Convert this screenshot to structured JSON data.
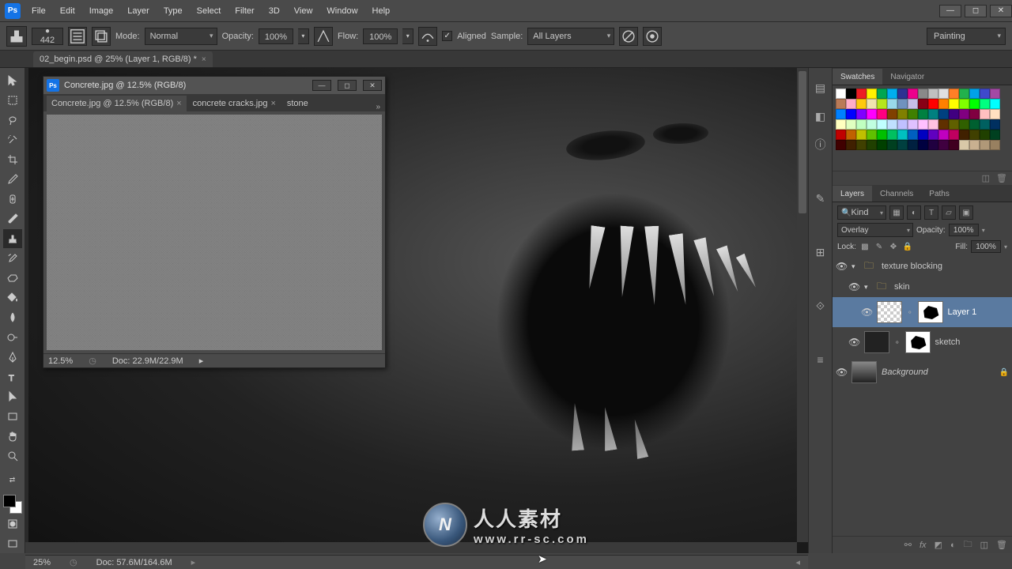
{
  "app": {
    "icon_label": "Ps"
  },
  "window_controls": {
    "minimize": "—",
    "maximize": "◻",
    "close": "✕"
  },
  "menu": [
    "File",
    "Edit",
    "Image",
    "Layer",
    "Type",
    "Select",
    "Filter",
    "3D",
    "View",
    "Window",
    "Help"
  ],
  "options_bar": {
    "brush_size": "442",
    "mode_label": "Mode:",
    "mode_value": "Normal",
    "opacity_label": "Opacity:",
    "opacity_value": "100%",
    "flow_label": "Flow:",
    "flow_value": "100%",
    "aligned_label": "Aligned",
    "aligned_checked": true,
    "sample_label": "Sample:",
    "sample_value": "All Layers",
    "workspace": "Painting"
  },
  "document_tab": {
    "title": "02_begin.psd @ 25% (Layer 1, RGB/8) *"
  },
  "float_window": {
    "title": "Concrete.jpg @ 12.5% (RGB/8)",
    "tabs": [
      {
        "label": "Concrete.jpg @ 12.5% (RGB/8)",
        "active": true
      },
      {
        "label": "concrete cracks.jpg",
        "active": false
      },
      {
        "label": "stone",
        "active": false
      }
    ],
    "more": "»",
    "status_zoom": "12.5%",
    "status_doc": "Doc: 22.9M/22.9M",
    "win_min": "—",
    "win_max": "◻",
    "win_close": "✕"
  },
  "swatches_panel": {
    "tabs": [
      "Swatches",
      "Navigator"
    ],
    "active": 0
  },
  "swatch_colors": [
    "#ffffff",
    "#000000",
    "#ed1c24",
    "#fff200",
    "#00a651",
    "#00aeef",
    "#2e3192",
    "#ec008c",
    "#898989",
    "#c0c0c0",
    "#e0e0e0",
    "#ff7f27",
    "#22b14c",
    "#00a2e8",
    "#3f48cc",
    "#a349a4",
    "#b97a57",
    "#ffaec9",
    "#ffc90e",
    "#efe4b0",
    "#b5e61d",
    "#99d9ea",
    "#7092be",
    "#c8bfe7",
    "#880015",
    "#ff0000",
    "#ff8000",
    "#ffff00",
    "#80ff00",
    "#00ff00",
    "#00ff80",
    "#00ffff",
    "#0080ff",
    "#0000ff",
    "#8000ff",
    "#ff00ff",
    "#ff0080",
    "#804000",
    "#808000",
    "#408000",
    "#008040",
    "#008080",
    "#004080",
    "#400080",
    "#800080",
    "#800040",
    "#ffc0c0",
    "#ffe0c0",
    "#ffffc0",
    "#e0ffc0",
    "#c0ffc0",
    "#c0ffe0",
    "#c0ffff",
    "#c0e0ff",
    "#c0c0ff",
    "#e0c0ff",
    "#ffc0ff",
    "#ffc0e0",
    "#603000",
    "#606000",
    "#306000",
    "#006030",
    "#006060",
    "#003060",
    "#c00000",
    "#c06000",
    "#c0c000",
    "#60c000",
    "#00c000",
    "#00c060",
    "#00c0c0",
    "#0060c0",
    "#0000c0",
    "#6000c0",
    "#c000c0",
    "#c00060",
    "#402000",
    "#404000",
    "#204000",
    "#004020",
    "#400000",
    "#402000",
    "#404000",
    "#204000",
    "#004000",
    "#004020",
    "#004040",
    "#002040",
    "#000040",
    "#200040",
    "#400040",
    "#400020",
    "#d8c8a8",
    "#c8b090",
    "#b09878",
    "#988060"
  ],
  "layers_panel": {
    "tabs": [
      "Layers",
      "Channels",
      "Paths"
    ],
    "active": 0,
    "kind": "Kind",
    "blend": "Overlay",
    "opacity_label": "Opacity:",
    "opacity_value": "100%",
    "lock_label": "Lock:",
    "fill_label": "Fill:",
    "fill_value": "100%",
    "layers": [
      {
        "type": "group",
        "name": "texture blocking",
        "expanded": true,
        "indent": 0
      },
      {
        "type": "group",
        "name": "skin",
        "expanded": true,
        "indent": 1
      },
      {
        "type": "layer",
        "name": "Layer 1",
        "indent": 2,
        "selected": true,
        "hasMask": true,
        "checker": true
      },
      {
        "type": "layer",
        "name": "sketch",
        "indent": 1,
        "hasMask": true
      },
      {
        "type": "bg",
        "name": "Background",
        "indent": 0,
        "locked": true
      }
    ]
  },
  "status_bar": {
    "zoom": "25%",
    "doc": "Doc: 57.6M/164.6M"
  },
  "watermark": {
    "globe": "N",
    "cn": "人人素材",
    "url": "www.rr-sc.com"
  }
}
